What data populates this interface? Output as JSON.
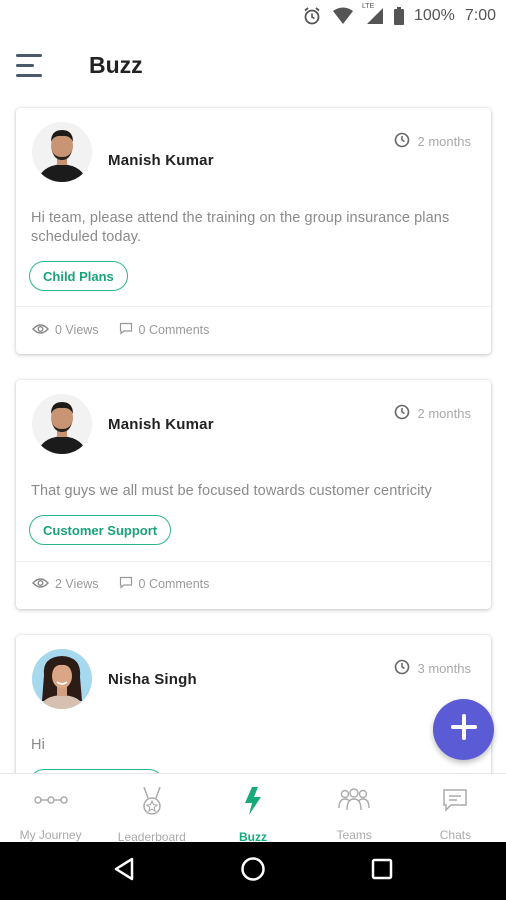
{
  "status_bar": {
    "battery": "100%",
    "time": "7:00",
    "network": "LTE"
  },
  "header": {
    "title": "Buzz"
  },
  "posts": [
    {
      "author": "Manish Kumar",
      "time": "2 months",
      "text": "Hi team, please attend the training on the group insurance plans scheduled today.",
      "tag": "Child Plans",
      "views": "0 Views",
      "comments": "0 Comments"
    },
    {
      "author": "Manish Kumar",
      "time": "2 months",
      "text": "That guys we all must be focused towards customer centricity",
      "tag": "Customer Support",
      "views": "2 Views",
      "comments": "0 Comments"
    },
    {
      "author": "Nisha Singh",
      "time": "3 months",
      "text": "Hi",
      "tag": "",
      "views": "",
      "comments": ""
    }
  ],
  "bottom_nav": [
    {
      "label": "My Journey",
      "icon": "journey-icon"
    },
    {
      "label": "Leaderboard",
      "icon": "trophy-icon"
    },
    {
      "label": "Buzz",
      "icon": "bolt-icon",
      "active": true
    },
    {
      "label": "Teams",
      "icon": "team-icon"
    },
    {
      "label": "Chats",
      "icon": "chat-icon"
    }
  ],
  "colors": {
    "accent": "#19a97b",
    "fab": "#5b5bd6",
    "tag_border": "#2bb58f",
    "muted_text": "#8a8a8a"
  }
}
